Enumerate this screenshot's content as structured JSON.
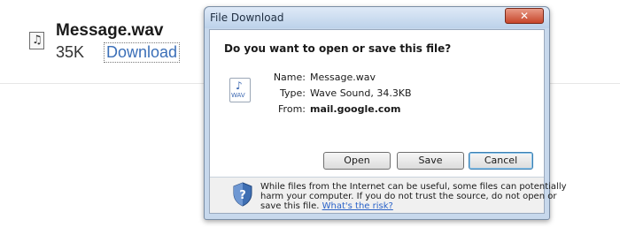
{
  "attachment": {
    "icon": "music-file-icon",
    "name": "Message.wav",
    "size": "35K",
    "download_label": "Download"
  },
  "dialog": {
    "title": "File Download",
    "close_icon": "close-icon",
    "question": "Do you want to open or save this file?",
    "file_icon": "wav-file-icon",
    "file_icon_label": "WAV",
    "name_label": "Name:",
    "name_value": "Message.wav",
    "type_label": "Type:",
    "type_value": "Wave Sound, 34.3KB",
    "from_label": "From:",
    "from_value": "mail.google.com",
    "buttons": {
      "open": "Open",
      "save": "Save",
      "cancel": "Cancel"
    },
    "warning": {
      "icon": "security-shield-icon",
      "line1": "While files from the Internet can be useful, some files can potentially",
      "line2": "harm your computer. If you do not trust the source, do not open or",
      "line3_prefix": "save this file.",
      "link": "What's the risk?"
    }
  },
  "colors": {
    "link": "#3b6fb8",
    "titlebar": "#c7d8ec",
    "close_button": "#c7462b",
    "default_button_border": "#3c7fb1"
  }
}
